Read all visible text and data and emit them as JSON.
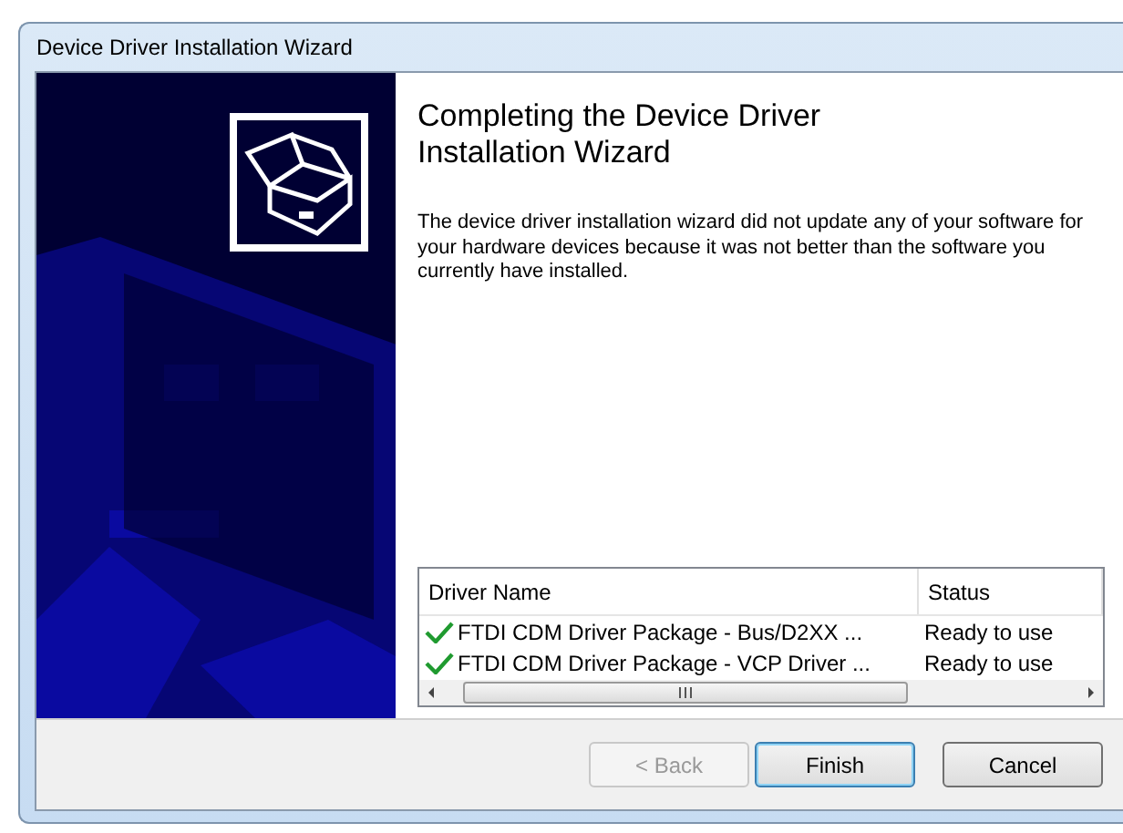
{
  "window": {
    "title": "Device Driver Installation Wizard"
  },
  "heading": "Completing the Device Driver Installation Wizard",
  "description": "The device driver installation wizard did not update any of your software for your hardware devices because it was not better than the software you currently have installed.",
  "table": {
    "columns": [
      "Driver Name",
      "Status"
    ],
    "rows": [
      {
        "kind": "check",
        "cells": [
          "FTDI CDM Driver Package - Bus/D2XX ...",
          "Ready to use"
        ]
      },
      {
        "kind": "check",
        "cells": [
          "FTDI CDM Driver Package - VCP Driver ...",
          "Ready to use"
        ]
      }
    ]
  },
  "buttons": [
    {
      "label": "< Back",
      "disabled": true,
      "default": false
    },
    {
      "label": "Finish",
      "disabled": false,
      "default": true
    },
    {
      "label": "Cancel",
      "disabled": false,
      "default": false
    }
  ]
}
